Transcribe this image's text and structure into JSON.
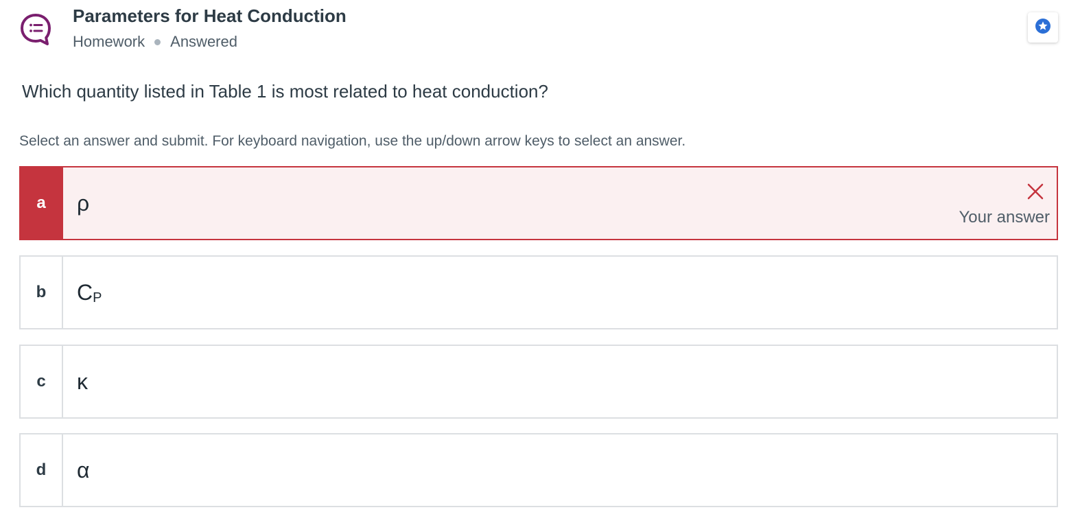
{
  "header": {
    "title": "Parameters for Heat Conduction",
    "type": "Homework",
    "status": "Answered",
    "question_icon": "question-bubble-icon",
    "favorite_icon": "star-icon"
  },
  "question": {
    "text": "Which quantity listed in Table 1 is most related to heat conduction?",
    "instructions": "Select an answer and submit. For keyboard navigation, use the up/down arrow keys to select an answer."
  },
  "options": [
    {
      "letter": "a",
      "value": "ρ",
      "state": "incorrect",
      "feedback_label": "Your answer"
    },
    {
      "letter": "b",
      "value": "C",
      "subscript": "P",
      "state": "none"
    },
    {
      "letter": "c",
      "value": "κ",
      "state": "none"
    },
    {
      "letter": "d",
      "value": "α",
      "state": "none"
    }
  ],
  "colors": {
    "incorrect": "#c5343e",
    "incorrect_bg": "#fbf0f1",
    "icon_purple": "#7a1f6e",
    "star_blue": "#2b6fd6"
  }
}
